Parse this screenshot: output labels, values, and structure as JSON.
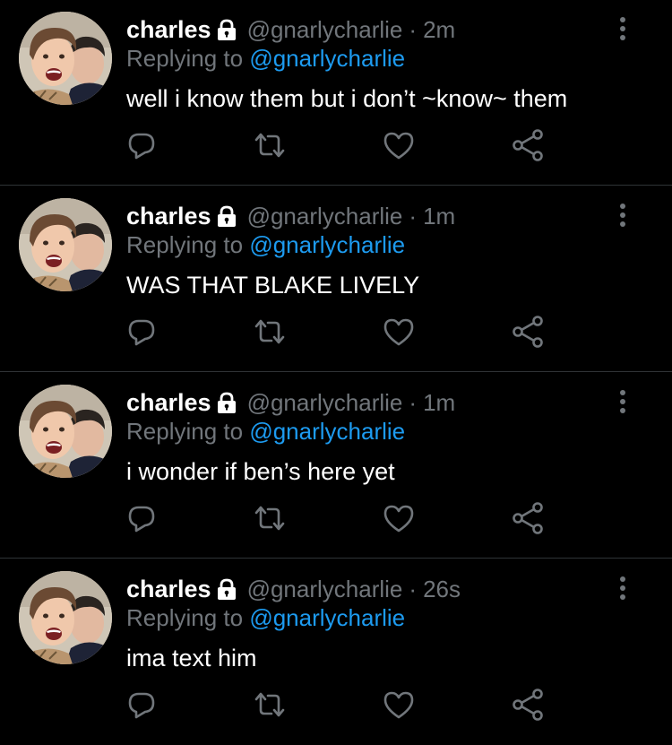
{
  "colors": {
    "background": "#000000",
    "name": "#ffffff",
    "secondary": "#71767b",
    "mention": "#1d9bf0",
    "divider": "#2f3336"
  },
  "tweets": [
    {
      "name": "charles",
      "handle": "@gnarlycharlie",
      "separator": "·",
      "time": "2m",
      "replying_prefix": "Replying to",
      "replying_to": "@gnarlycharlie",
      "text": "well i know them but i don’t ~know~ them"
    },
    {
      "name": "charles",
      "handle": "@gnarlycharlie",
      "separator": "·",
      "time": "1m",
      "replying_prefix": "Replying to",
      "replying_to": "@gnarlycharlie",
      "text": "WAS THAT BLAKE LIVELY"
    },
    {
      "name": "charles",
      "handle": "@gnarlycharlie",
      "separator": "·",
      "time": "1m",
      "replying_prefix": "Replying to",
      "replying_to": "@gnarlycharlie",
      "text": "i wonder if ben’s here yet"
    },
    {
      "name": "charles",
      "handle": "@gnarlycharlie",
      "separator": "·",
      "time": "26s",
      "replying_prefix": "Replying to",
      "replying_to": "@gnarlycharlie",
      "text": "ima text him"
    }
  ],
  "icons": {
    "protected": "lock-icon",
    "more": "more-vertical-icon",
    "reply": "reply-icon",
    "retweet": "retweet-icon",
    "like": "heart-icon",
    "share": "share-icon"
  }
}
